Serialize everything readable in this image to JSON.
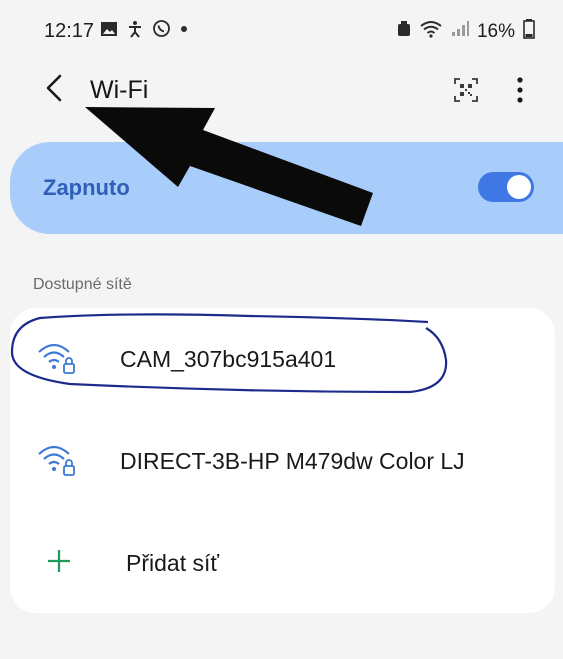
{
  "status_bar": {
    "time": "12:17",
    "battery": "16%",
    "left_icons": [
      "gallery-icon",
      "accessibility-icon",
      "whatsapp-icon",
      "dot-icon"
    ],
    "right_icons": [
      "alarm-icon",
      "wifi-signal-icon",
      "cell-signal-icon",
      "battery-icon"
    ]
  },
  "app_bar": {
    "back_icon": "chevron-left-icon",
    "title": "Wi-Fi",
    "qr_icon": "qr-code-icon",
    "more_icon": "more-vert-icon"
  },
  "master_switch": {
    "label": "Zapnuto",
    "enabled": true
  },
  "available_networks": {
    "header": "Dostupné sítě",
    "items": [
      {
        "name": "CAM_307bc915a401",
        "icon": "wifi-lock-icon"
      },
      {
        "name": "DIRECT-3B-HP M479dw Color LJ",
        "icon": "wifi-lock-icon"
      }
    ],
    "add_network": {
      "label": "Přidat síť",
      "icon": "plus-icon"
    }
  },
  "colors": {
    "accent": "#3f77e4",
    "switch_bg": "#a9cdfb",
    "switch_text": "#2f5fb6",
    "wifi_icon": "#3a7ad6",
    "plus_icon": "#1f9a5a",
    "annotation_arrow": "#0a0a0a",
    "annotation_circle": "#1c2a8c"
  }
}
